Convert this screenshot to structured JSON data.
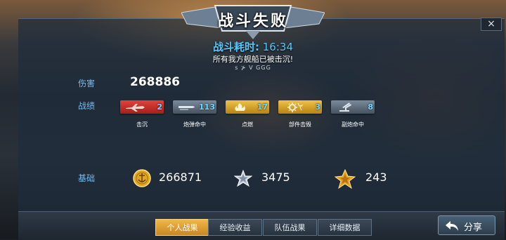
{
  "header": {
    "title": "战斗失败",
    "close_label": "×",
    "time_label": "战斗耗时:",
    "time_value": "16:34",
    "status_message": "所有我方舰船已被击沉!",
    "player_line": "s ⊁   V   GGG"
  },
  "labels": {
    "damage": "伤害",
    "achievements": "战绩",
    "base": "基础"
  },
  "damage_value": "268886",
  "achievements": [
    {
      "name": "击沉",
      "count": "2",
      "color": "#c9302c",
      "icon": "plane-icon"
    },
    {
      "name": "炮弹命中",
      "count": "113",
      "color": "#5b6b7d",
      "icon": "shell-icon"
    },
    {
      "name": "点燃",
      "count": "17",
      "color": "#d8a21e",
      "icon": "fire-icon"
    },
    {
      "name": "部件击毁",
      "count": "3",
      "color": "#d8a21e",
      "icon": "gear-burst-icon"
    },
    {
      "name": "副炮命中",
      "count": "8",
      "color": "#5b6b7d",
      "icon": "secondary-gun-icon"
    }
  ],
  "base_rewards": [
    {
      "value": "266871",
      "icon": "gold-coin-icon"
    },
    {
      "value": "3475",
      "icon": "silver-star-icon"
    },
    {
      "value": "243",
      "icon": "gold-star-icon"
    }
  ],
  "tabs": [
    {
      "label": "个人战果",
      "active": true
    },
    {
      "label": "经验收益",
      "active": false
    },
    {
      "label": "队伍战果",
      "active": false
    },
    {
      "label": "详细数据",
      "active": false
    }
  ],
  "share_label": "分享"
}
